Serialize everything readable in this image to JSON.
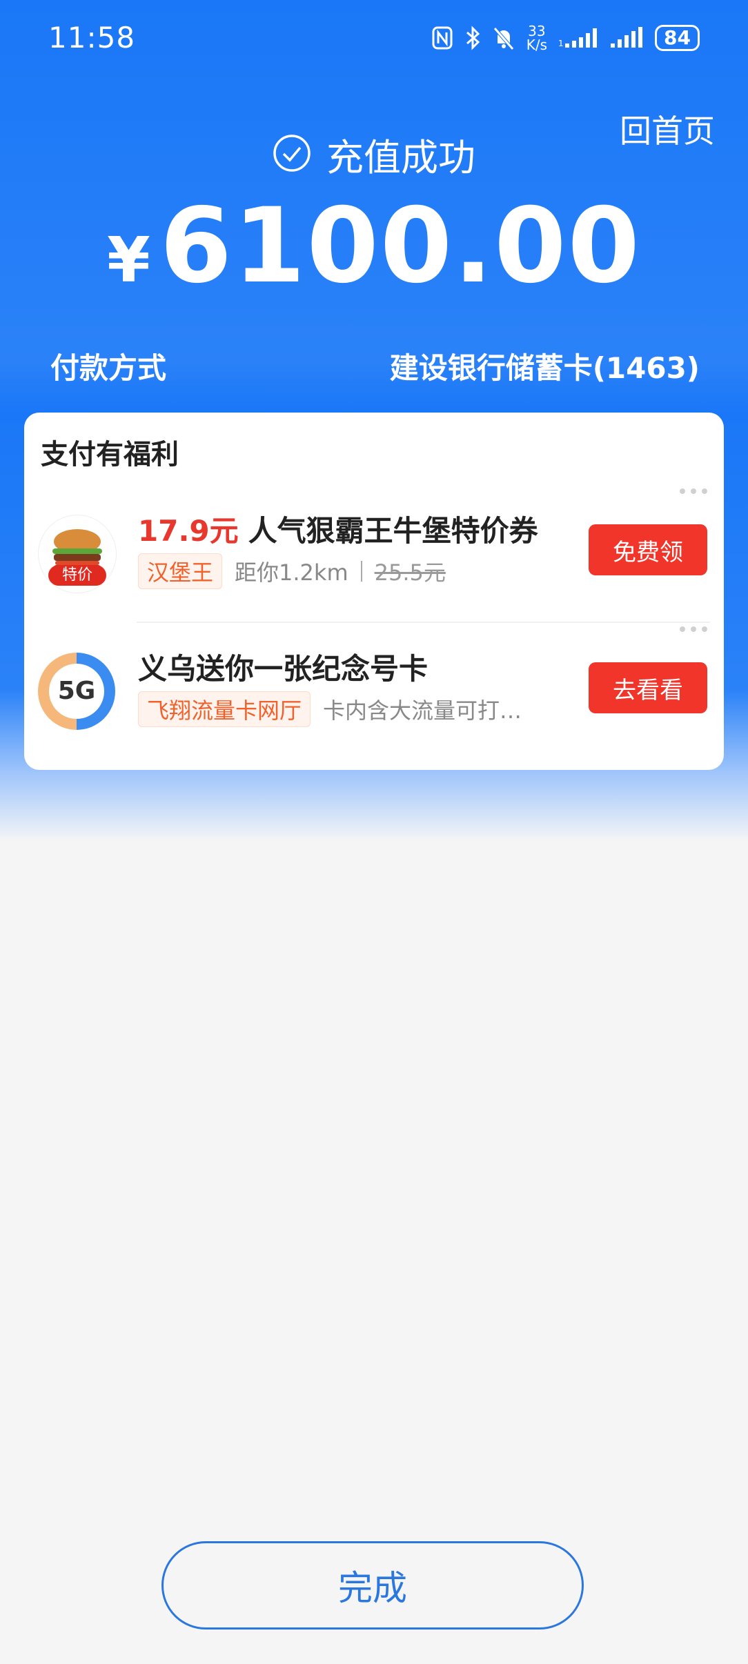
{
  "status_bar": {
    "time": "11:58",
    "net_speed_value": "33",
    "net_speed_unit": "K/s",
    "battery": "84",
    "icons": [
      "nfc-icon",
      "bluetooth-icon",
      "mute-bell-icon",
      "signal-icon",
      "signal-icon",
      "battery-icon"
    ]
  },
  "header": {
    "home_label": "回首页",
    "success_label": "充值成功",
    "currency_symbol": "¥",
    "amount": "6100.00"
  },
  "payment": {
    "label": "付款方式",
    "method": "建设银行储蓄卡(1463)"
  },
  "benefits": {
    "title": "支付有福利",
    "offers": [
      {
        "price": "17.9元",
        "title": "人气狠霸王牛堡特价券",
        "merchant_tag": "汉堡王",
        "distance": "距你1.2km",
        "original_price": "25.5元",
        "thumb_tag": "特价",
        "button": "免费领"
      },
      {
        "title": "义乌送你一张纪念号卡",
        "merchant_tag": "飞翔流量卡网厅",
        "description": "卡内含大流量可打…",
        "thumb_label": "5G",
        "button": "去看看"
      }
    ]
  },
  "footer": {
    "done_label": "完成"
  },
  "colors": {
    "brand_blue": "#1a77f7",
    "accent_red": "#f1352b",
    "tag_orange": "#f0612c",
    "done_border": "#2a77e0"
  }
}
